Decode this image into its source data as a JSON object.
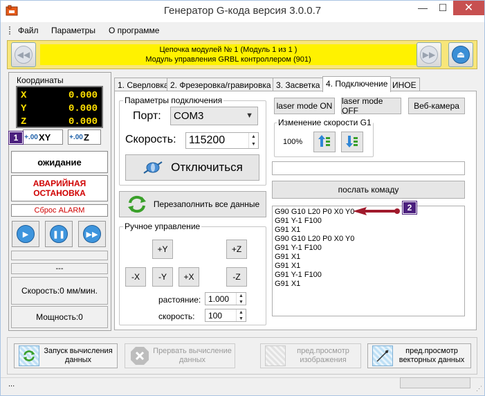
{
  "window": {
    "title": "Генератор G-кода версия 3.0.0.7",
    "minimize": "—",
    "maximize": "☐",
    "close": "✕"
  },
  "menu": {
    "items": [
      "Файл",
      "Параметры",
      "О программе"
    ]
  },
  "banner": {
    "line1": "Цепочка модулей № 1 (Модуль 1 из 1 )",
    "line2": "Модуль управления GRBL контроллером (901)",
    "prev": "◀◀",
    "next": "▶▶",
    "eject": "⏏"
  },
  "coords": {
    "label": "Координаты",
    "rows": [
      {
        "axis": "X",
        "value": "0.000"
      },
      {
        "axis": "Y",
        "value": "0.000"
      },
      {
        "axis": "Z",
        "value": "0.000"
      }
    ],
    "zero_xy": "XY",
    "zero_z": "Z",
    "zero_icon": "+.00"
  },
  "left": {
    "status": "ожидание",
    "emergency": "АВАРИЙНАЯ ОСТАНОВКА",
    "reset_alarm": "Сброс ALARM",
    "blank_field": "---",
    "speed": "Скорость:0 мм/мин.",
    "power": "Мощность:0",
    "play": "▶",
    "pause": "❚❚",
    "forward": "▶▶"
  },
  "tabs": [
    "1. Сверловка",
    "2. Фрезеровка/гравировка",
    "3. Засветка",
    "4. Подключение",
    "ИНОЕ"
  ],
  "connection": {
    "group_title": "Параметры подключения",
    "port_label": "Порт:",
    "port_value": "COM3",
    "speed_label": "Скорость:",
    "speed_value": "115200",
    "disconnect": "Отключиться",
    "refill": "Перезаполнить все данные"
  },
  "manual": {
    "group_title": "Ручное управление",
    "plus_y": "+Y",
    "minus_y": "-Y",
    "plus_x": "+X",
    "minus_x": "-X",
    "plus_z": "+Z",
    "minus_z": "-Z",
    "distance_label": "растояние:",
    "distance_value": "1.000",
    "speed_label": "скорость:",
    "speed_value": "100"
  },
  "right": {
    "laser_on": "laser mode ON",
    "laser_off": "laser mode OFF",
    "webcam": "Веб-камера",
    "speed_group": "Изменение скорости G1",
    "speed_percent": "100%",
    "send": "послать комаду",
    "command_input": "",
    "gcode_lines": [
      "G90 G10 L20 P0 X0 Y0",
      "G91 Y-1 F100",
      "G91 X1",
      "G90 G10 L20 P0 X0 Y0",
      "G91 Y-1 F100",
      "G91 X1",
      "G91 X1",
      "G91 Y-1 F100",
      "G91 X1"
    ]
  },
  "callouts": {
    "one": "1",
    "two": "2"
  },
  "toolbar": {
    "start_calc": "Запуск вычисления данных",
    "stop_calc": "Прервать вычисление данных",
    "preview_image": "пред.просмотр изображения",
    "preview_vector": "пред.просмотр векторных данных"
  },
  "statusbar": {
    "text": "..."
  },
  "colors": {
    "banner": "#fff200",
    "coord_text": "#ffe000",
    "emergency": "#d00000",
    "callout": "#4b1f7e",
    "arrow": "#a01a2c"
  }
}
